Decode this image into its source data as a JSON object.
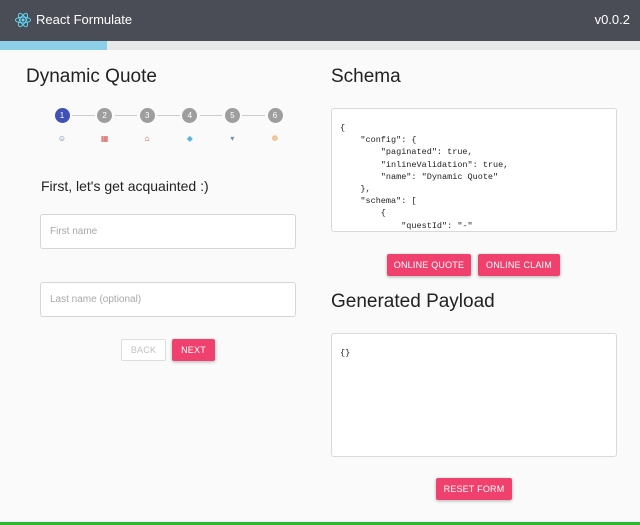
{
  "app": {
    "title": "React Formulate",
    "version": "v0.0.2",
    "logo_icon": "react-atom-icon",
    "header_color": "#4a4d55"
  },
  "progress": {
    "fraction": 0.1667,
    "color": "#8ecfe8"
  },
  "left": {
    "title": "Dynamic Quote",
    "steps": [
      {
        "number": "1",
        "icon": "person-icon",
        "active": true
      },
      {
        "number": "2",
        "icon": "calendar-icon",
        "active": false
      },
      {
        "number": "3",
        "icon": "house-icon",
        "active": false
      },
      {
        "number": "4",
        "icon": "gem-icon",
        "active": false
      },
      {
        "number": "5",
        "icon": "tray-icon",
        "active": false
      },
      {
        "number": "6",
        "icon": "handshake-icon",
        "active": false
      }
    ],
    "prompt": "First, let's get acquainted :)",
    "first_name": {
      "placeholder": "First name",
      "value": ""
    },
    "last_name": {
      "placeholder": "Last name (optional)",
      "value": ""
    },
    "back_label": "BACK",
    "next_label": "NEXT"
  },
  "right": {
    "schema_title": "Schema",
    "schema_code": "{\n    \"config\": {\n        \"paginated\": true,\n        \"inlineValidation\": true,\n        \"name\": \"Dynamic Quote\"\n    },\n    \"schema\": [\n        {\n            \"questId\": \"-\"",
    "online_quote_label": "ONLINE QUOTE",
    "online_claim_label": "ONLINE CLAIM",
    "payload_title": "Generated Payload",
    "payload_code": "{}",
    "reset_label": "RESET FORM"
  },
  "colors": {
    "accent": "#f0416e",
    "active_step": "#3f51b5",
    "inactive_step": "#9e9e9e"
  }
}
